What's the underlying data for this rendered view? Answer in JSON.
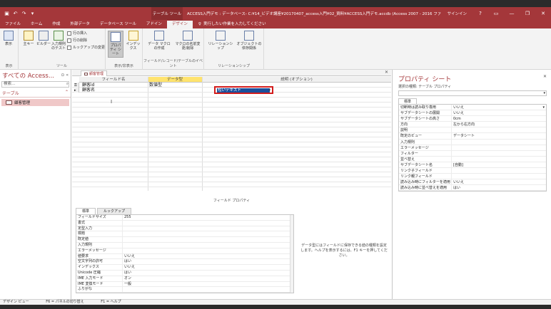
{
  "titlebar": {
    "context_tools": "テーブル ツール",
    "document_title": "ACCESS入門デモ : データベース- C:¥14_ビデオ講座¥20170407_access入門¥02_資料¥ACCESS入門デモ.accdb (Access 2007 - 2016 ファイル形式) - Access",
    "signin": "サインイン",
    "help": "?",
    "minimize": "—",
    "restore": "❐",
    "close": "✕"
  },
  "ribbon_tabs": [
    "ファイル",
    "ホーム",
    "作成",
    "外部データ",
    "データベース ツール",
    "アドイン",
    "デザイン"
  ],
  "active_tab_index": 6,
  "tell_me": "実行したい作業を入力してください",
  "ribbon": {
    "view": {
      "label": "表示",
      "group": "表示"
    },
    "tools": {
      "primary_key": "主キー",
      "builder": "ビルダー",
      "test_rules": "入力規則のテスト",
      "insert_rows": "行の挿入",
      "delete_rows": "行の削除",
      "modify_lookups": "ルックアップの変更",
      "group": "ツール"
    },
    "show_hide": {
      "property_sheet": "プロパティ シート",
      "indexes": "インデックス",
      "group": "表示/非表示"
    },
    "events": {
      "data_macro": "データ マクロの作成",
      "rename_macro": "マクロの名前変更/削除",
      "group": "フィールド/レコード/テーブルのイベント"
    },
    "relationships": {
      "relationships": "リレーションシップ",
      "dependencies": "オブジェクトの依存関係",
      "group": "リレーションシップ"
    }
  },
  "navpane": {
    "title": "すべての Access...",
    "search_placeholder": "検索...",
    "group": "テーブル",
    "items": [
      {
        "label": "顧客管理"
      }
    ]
  },
  "doc_tab": {
    "label": "顧客管理"
  },
  "design_grid": {
    "headers": {
      "field_name": "フィールド名",
      "data_type": "データ型",
      "description": "説明 (オプション)"
    },
    "rows": [
      {
        "name": "顧客id",
        "type": "数値型",
        "primary_key": true
      },
      {
        "name": "顧客名",
        "type": "短いテキスト",
        "primary_key": false
      }
    ],
    "dropdown_value": "短いテキスト"
  },
  "field_properties": {
    "title": "フィールド プロパティ",
    "tabs": [
      "標準",
      "ルックアップ"
    ],
    "rows": [
      {
        "k": "フィールドサイズ",
        "v": "255"
      },
      {
        "k": "書式",
        "v": ""
      },
      {
        "k": "定型入力",
        "v": ""
      },
      {
        "k": "標題",
        "v": ""
      },
      {
        "k": "既定値",
        "v": ""
      },
      {
        "k": "入力規則",
        "v": ""
      },
      {
        "k": "エラーメッセージ",
        "v": ""
      },
      {
        "k": "値要求",
        "v": "いいえ"
      },
      {
        "k": "空文字列の許可",
        "v": "はい"
      },
      {
        "k": "インデックス",
        "v": "いいえ"
      },
      {
        "k": "Unicode 圧縮",
        "v": "はい"
      },
      {
        "k": "IME 入力モード",
        "v": "オン"
      },
      {
        "k": "IME 変換モード",
        "v": "一般"
      },
      {
        "k": "ふりがな",
        "v": ""
      }
    ],
    "help_text": "データ型にはフィールドに保存できる値の種類を設定します。ヘルプを表示するには、F1 キーを押してください。"
  },
  "property_sheet": {
    "title": "プロパティ シート",
    "selection_type": "選択の種類: テーブル プロパティ",
    "tab": "標準",
    "rows": [
      {
        "k": "切断時は読み取り専用",
        "v": "いいえ"
      },
      {
        "k": "サブデータシートの展開",
        "v": "いいえ"
      },
      {
        "k": "サブデータシートの高さ",
        "v": "0cm"
      },
      {
        "k": "方向",
        "v": "左から右方向"
      },
      {
        "k": "説明",
        "v": ""
      },
      {
        "k": "既定のビュー",
        "v": "データシート"
      },
      {
        "k": "入力規則",
        "v": ""
      },
      {
        "k": "エラーメッセージ",
        "v": ""
      },
      {
        "k": "フィルター",
        "v": ""
      },
      {
        "k": "並べ替え",
        "v": ""
      },
      {
        "k": "サブデータシート名",
        "v": "[自動]"
      },
      {
        "k": "リンク子フィールド",
        "v": ""
      },
      {
        "k": "リンク親フィールド",
        "v": ""
      },
      {
        "k": "読み込み時にフィルターを適用",
        "v": "いいえ"
      },
      {
        "k": "読み込み時に並べ替えを適用",
        "v": "はい"
      }
    ]
  },
  "statusbar": {
    "view": "デザイン ビュー",
    "f6": "F6 = パネルの切り替え",
    "f1": "F1 = ヘルプ"
  }
}
